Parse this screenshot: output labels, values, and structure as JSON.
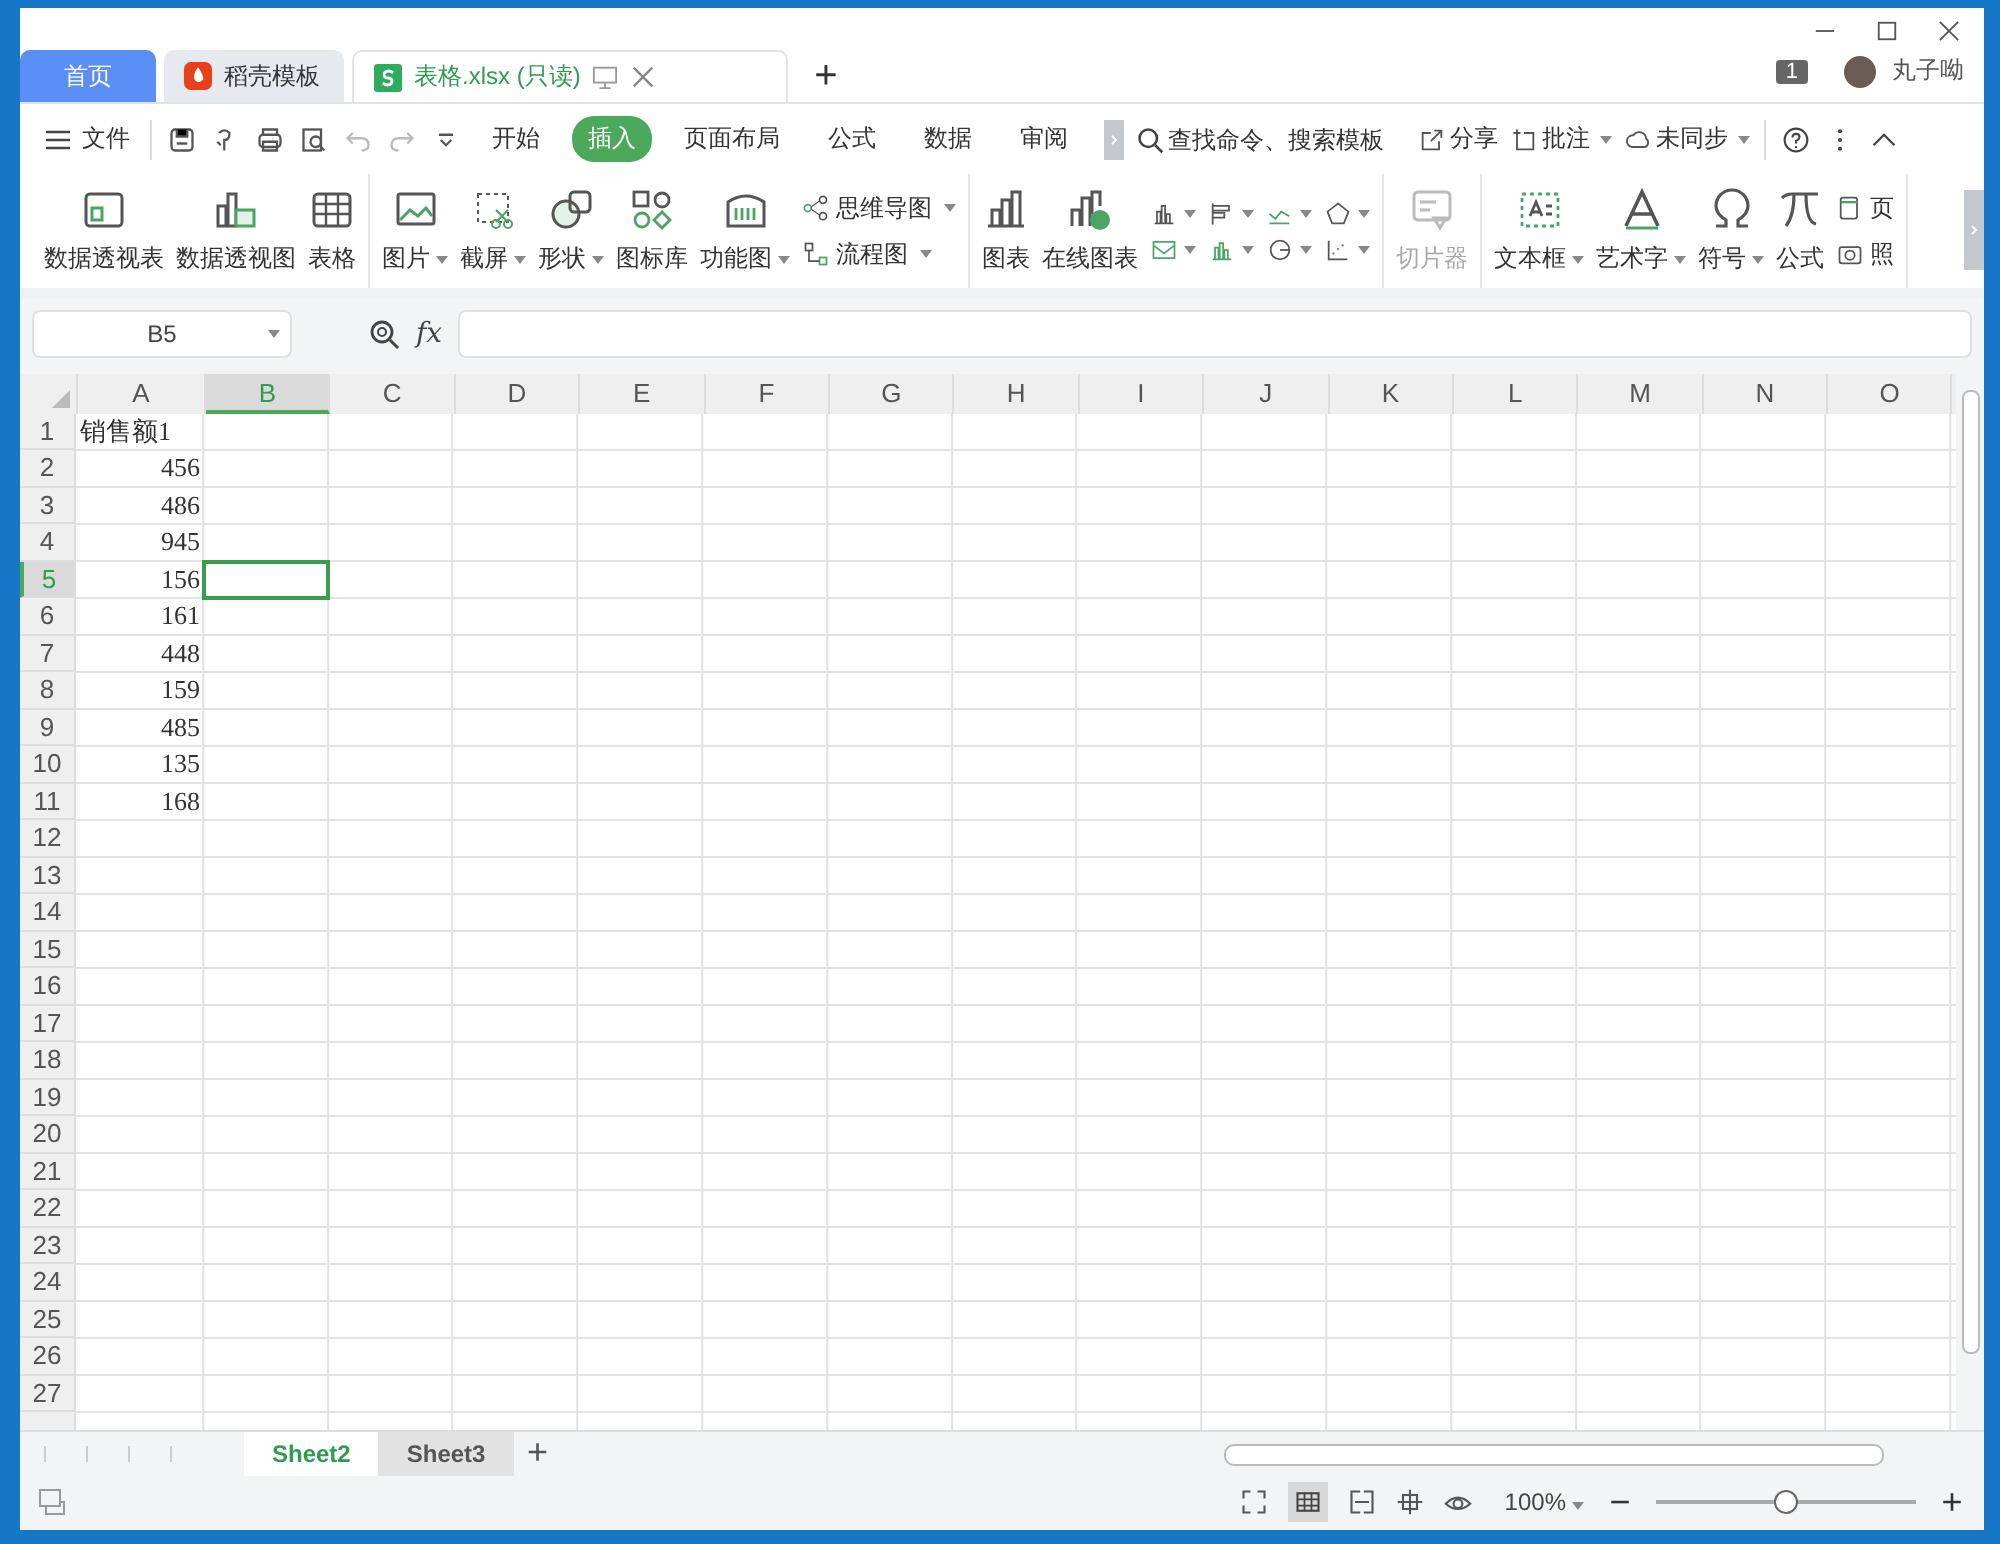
{
  "tabs": [
    {
      "label": "首页",
      "kind": "home",
      "selected": false
    },
    {
      "label": "稻壳模板",
      "kind": "template",
      "selected": false
    },
    {
      "label": "表格.xlsx (只读)",
      "kind": "sheet",
      "selected": true
    }
  ],
  "new_tab": "+",
  "notification_count": "1",
  "user": {
    "name": "丸子呦"
  },
  "menu": {
    "file": "文件",
    "tabs": [
      {
        "label": "开始",
        "selected": false
      },
      {
        "label": "插入",
        "selected": true
      },
      {
        "label": "页面布局",
        "selected": false
      },
      {
        "label": "公式",
        "selected": false
      },
      {
        "label": "数据",
        "selected": false
      },
      {
        "label": "审阅",
        "selected": false
      }
    ]
  },
  "search": {
    "placeholder": "查找命令、搜索模板"
  },
  "actions": [
    {
      "label": "分享",
      "kind": "share",
      "dropdown": false
    },
    {
      "label": "批注",
      "kind": "comment",
      "dropdown": true
    },
    {
      "label": "未同步",
      "kind": "cloud",
      "dropdown": true
    }
  ],
  "ribbon": [
    {
      "items": [
        {
          "kind": "pivot-table",
          "label": "数据透视表",
          "dropdown": false,
          "disabled": false
        },
        {
          "kind": "pivot-chart",
          "label": "数据透视图",
          "dropdown": false,
          "disabled": false
        },
        {
          "kind": "table",
          "label": "表格",
          "dropdown": false,
          "disabled": false
        }
      ]
    },
    {
      "items": [
        {
          "kind": "picture",
          "label": "图片",
          "dropdown": true,
          "disabled": false
        },
        {
          "kind": "screenshot",
          "label": "截屏",
          "dropdown": true,
          "disabled": false
        },
        {
          "kind": "shapes",
          "label": "形状",
          "dropdown": true,
          "disabled": false
        },
        {
          "kind": "icon-library",
          "label": "图标库",
          "dropdown": false,
          "disabled": false
        },
        {
          "kind": "barcode",
          "label": "功能图",
          "dropdown": true,
          "disabled": false
        }
      ],
      "small": [
        {
          "kind": "mind-map",
          "label": "思维导图",
          "dropdown": true
        },
        {
          "kind": "flowchart",
          "label": "流程图",
          "dropdown": true
        }
      ]
    },
    {
      "items": [
        {
          "kind": "chart",
          "label": "图表",
          "dropdown": false,
          "disabled": false
        },
        {
          "kind": "online-chart",
          "label": "在线图表",
          "dropdown": false,
          "disabled": false
        }
      ],
      "chart_types": [
        {
          "dropdown": true
        },
        {
          "dropdown": true
        },
        {
          "dropdown": true
        },
        {
          "dropdown": true
        },
        {
          "dropdown": true
        },
        {
          "dropdown": true
        },
        {
          "dropdown": true
        },
        {
          "dropdown": true
        }
      ]
    },
    {
      "items": [
        {
          "kind": "slicer",
          "label": "切片器",
          "dropdown": false,
          "disabled": true
        }
      ]
    },
    {
      "items": [
        {
          "kind": "text-box",
          "label": "文本框",
          "dropdown": true,
          "disabled": false
        },
        {
          "kind": "word-art",
          "label": "艺术字",
          "dropdown": true,
          "disabled": false
        },
        {
          "kind": "omega",
          "label": "符号",
          "dropdown": true,
          "disabled": false
        },
        {
          "kind": "pi",
          "label": "公式",
          "dropdown": false,
          "disabled": false
        }
      ],
      "small": [
        {
          "kind": "header",
          "label": "页",
          "dropdown": false
        },
        {
          "kind": "camera",
          "label": "照",
          "dropdown": false
        }
      ]
    }
  ],
  "formula_bar": {
    "name_box": "B5",
    "fx": "fx"
  },
  "columns": [
    {
      "label": "A",
      "selected": false
    },
    {
      "label": "B",
      "selected": true
    },
    {
      "label": "C",
      "selected": false
    },
    {
      "label": "D",
      "selected": false
    },
    {
      "label": "E",
      "selected": false
    },
    {
      "label": "F",
      "selected": false
    },
    {
      "label": "G",
      "selected": false
    },
    {
      "label": "H",
      "selected": false
    },
    {
      "label": "I",
      "selected": false
    },
    {
      "label": "J",
      "selected": false
    },
    {
      "label": "K",
      "selected": false
    },
    {
      "label": "L",
      "selected": false
    },
    {
      "label": "M",
      "selected": false
    },
    {
      "label": "N",
      "selected": false
    },
    {
      "label": "O",
      "selected": false
    }
  ],
  "rows": [
    {
      "header": "1",
      "selected": false,
      "value": "销售额1",
      "kind": "text"
    },
    {
      "header": "2",
      "selected": false,
      "value": "456",
      "kind": "number"
    },
    {
      "header": "3",
      "selected": false,
      "value": "486",
      "kind": "number"
    },
    {
      "header": "4",
      "selected": false,
      "value": "945",
      "kind": "number"
    },
    {
      "header": "5",
      "selected": true,
      "value": "156",
      "kind": "number"
    },
    {
      "header": "6",
      "selected": false,
      "value": "161",
      "kind": "number"
    },
    {
      "header": "7",
      "selected": false,
      "value": "448",
      "kind": "number"
    },
    {
      "header": "8",
      "selected": false,
      "value": "159",
      "kind": "number"
    },
    {
      "header": "9",
      "selected": false,
      "value": "485",
      "kind": "number"
    },
    {
      "header": "10",
      "selected": false,
      "value": "135",
      "kind": "number"
    },
    {
      "header": "11",
      "selected": false,
      "value": "168",
      "kind": "number"
    },
    {
      "header": "12",
      "selected": false
    },
    {
      "header": "13",
      "selected": false
    },
    {
      "header": "14",
      "selected": false
    },
    {
      "header": "15",
      "selected": false
    },
    {
      "header": "16",
      "selected": false
    },
    {
      "header": "17",
      "selected": false
    },
    {
      "header": "18",
      "selected": false
    },
    {
      "header": "19",
      "selected": false
    },
    {
      "header": "20",
      "selected": false
    },
    {
      "header": "21",
      "selected": false
    },
    {
      "header": "22",
      "selected": false
    },
    {
      "header": "23",
      "selected": false
    },
    {
      "header": "24",
      "selected": false
    },
    {
      "header": "25",
      "selected": false
    },
    {
      "header": "26",
      "selected": false
    },
    {
      "header": "27",
      "selected": false
    }
  ],
  "sheets": [
    {
      "label": "Sheet2",
      "selected": true
    },
    {
      "label": "Sheet3",
      "selected": false
    }
  ],
  "add_sheet": "+",
  "status_bar": {
    "zoom": "100%",
    "zoom_slider": {
      "level": 0.5
    },
    "zoom_out": "−",
    "zoom_in": "+"
  }
}
